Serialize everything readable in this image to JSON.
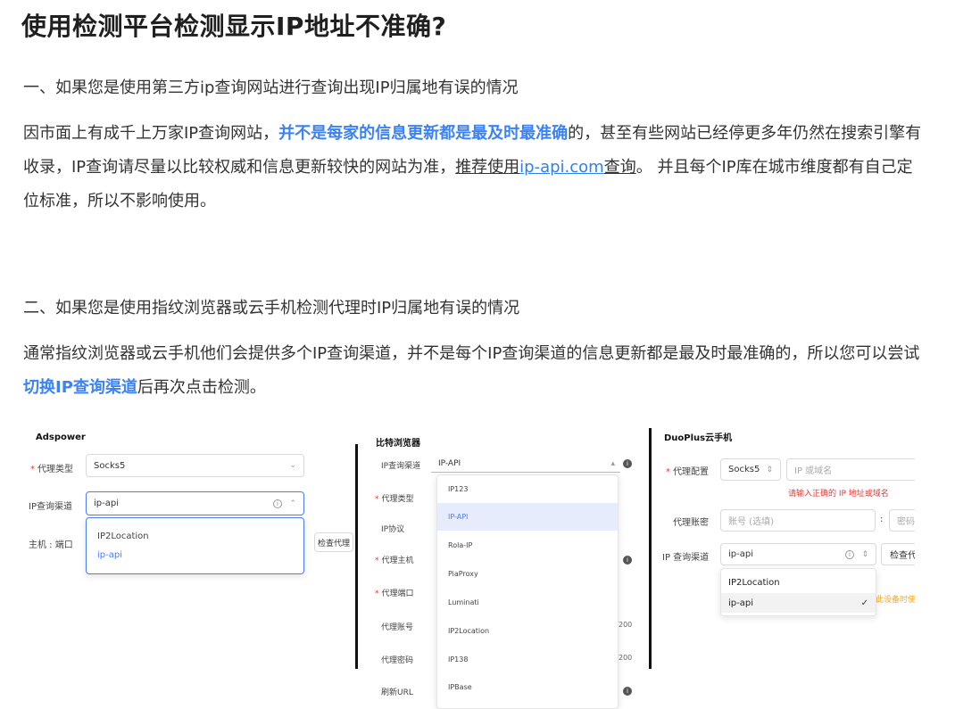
{
  "title": "使用检测平台检测显示IP地址不准确?",
  "section1": {
    "heading": "一、如果您是使用第三方ip查询网站进行查询出现IP归属地有误的情况",
    "p_a": "因市面上有成千上万家IP查询网站，",
    "p_hl": "并不是每家的信息更新都是最及时最准确",
    "p_b": "的，甚至有些网站已经停更多年仍然在搜索引擎有收录，IP查询请尽量以比较权威和信息更新较快的网站为准，",
    "p_ul1": "推荐使用",
    "p_link": "ip-api.com",
    "p_ul2": "查询",
    "p_c": "。 并且每个IP库在城市维度都有自己定位标准，所以不影响使用。"
  },
  "section2": {
    "heading": "二、如果您是使用指纹浏览器或云手机检测代理时IP归属地有误的情况",
    "p_a": "通常指纹浏览器或云手机他们会提供多个IP查询渠道，并不是每个IP查询渠道的信息更新都是最及时最准确的，所以您可以尝试",
    "p_hl": "切换IP查询渠道",
    "p_b": "后再次点击检测。"
  },
  "adspower": {
    "title": "Adspower",
    "proxy_type_label": "代理类型",
    "proxy_type_value": "Socks5",
    "channel_label": "IP查询渠道",
    "channel_value": "ip-api",
    "host_label": "主机 : 端口",
    "check_btn": "检查代理",
    "options": [
      "IP2Location",
      "ip-api"
    ]
  },
  "bitbrowser": {
    "title": "比特浏览器",
    "channel_label": "IP查询渠道",
    "channel_value": "IP-API",
    "proxy_type_label": "代理类型",
    "protocol_label": "IP协议",
    "host_label": "代理主机",
    "port_label": "代理端口",
    "account_label": "代理账号",
    "password_label": "代理密码",
    "refresh_label": "刷新URL",
    "right_vals": [
      "200",
      "200"
    ],
    "options": [
      "IP123",
      "IP-API",
      "Rola-IP",
      "PiaProxy",
      "Luminati",
      "IP2Location",
      "IP138",
      "IPBase"
    ]
  },
  "duoplus": {
    "title": "DuoPlus云手机",
    "config_label": "代理配置",
    "proxy_type_value": "Socks5",
    "ip_placeholder": "IP 或域名",
    "error_text": "请输入正确的 IP 地址或域名",
    "account_label": "代理账密",
    "account_placeholder": "账号 (选填)",
    "pwd_placeholder": "密码",
    "colon": ":",
    "channel_label": "IP 查询渠道",
    "channel_value": "ip-api",
    "check_btn": "检查代",
    "warn_text": "此设备时使",
    "options": [
      "IP2Location",
      "ip-api"
    ]
  }
}
